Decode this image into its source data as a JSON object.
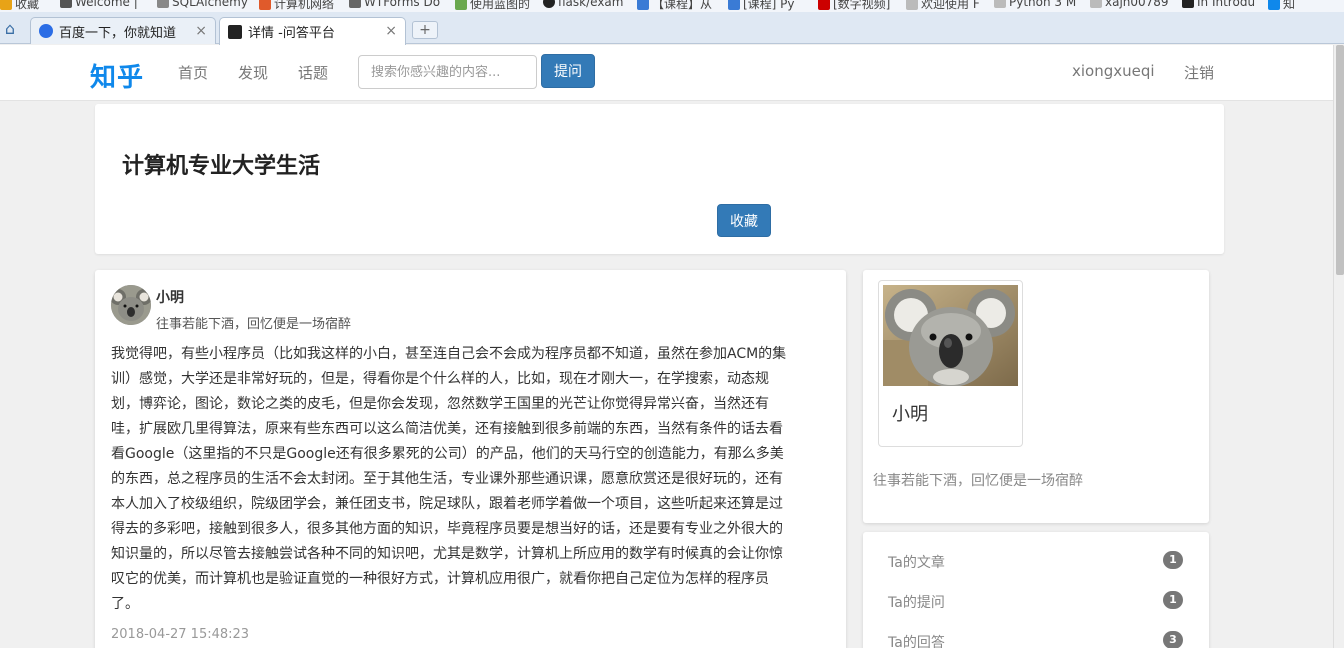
{
  "bookmarks": [
    {
      "label": "收藏",
      "icon": "star-icon",
      "color": "#e8a317"
    },
    {
      "label": "Welcome |",
      "icon": "site-icon",
      "color": "#555555"
    },
    {
      "label": "SQLAlchemy",
      "icon": "sqlalchemy-icon",
      "color": "#888888"
    },
    {
      "label": "计算机网络",
      "icon": "site-icon",
      "color": "#e05a2b"
    },
    {
      "label": "WTForms Do",
      "icon": "doc-icon",
      "color": "#666666"
    },
    {
      "label": "使用蓝图的",
      "icon": "site-icon",
      "color": "#6aa84f"
    },
    {
      "label": "flask/exam",
      "icon": "github-icon",
      "color": "#222222"
    },
    {
      "label": "【课程】从",
      "icon": "site-icon",
      "color": "#3a7bd5"
    },
    {
      "label": "[课程] Py",
      "icon": "site-icon",
      "color": "#3a7bd5"
    },
    {
      "label": "[数字视频]",
      "icon": "site-icon",
      "color": "#cc0000"
    },
    {
      "label": "欢迎使用 F",
      "icon": "page-icon",
      "color": "#888888"
    },
    {
      "label": "Python 3 M",
      "icon": "page-icon",
      "color": "#888888"
    },
    {
      "label": "xajh00789",
      "icon": "page-icon",
      "color": "#888888"
    },
    {
      "label": "In Introdu",
      "icon": "terminal-icon",
      "color": "#222222"
    },
    {
      "label": "知",
      "icon": "zhihu-icon",
      "color": "#0f88eb"
    }
  ],
  "tabs": [
    {
      "label": "百度一下，你就知道",
      "icon": "baidu-paw-icon",
      "icon_color": "#2b6de5",
      "active": false
    },
    {
      "label": "详情 -问答平台",
      "icon": "terminal-icon",
      "icon_color": "#222222",
      "active": true
    }
  ],
  "tab_close_glyph": "×",
  "new_tab_glyph": "+",
  "home_glyph": "⌂",
  "navbar": {
    "brand": "知乎",
    "links": [
      "首页",
      "发现",
      "话题"
    ],
    "search_placeholder": "搜索你感兴趣的内容...",
    "ask_button": "提问",
    "username": "xiongxueqi",
    "logout": "注销"
  },
  "question": {
    "title": "计算机专业大学生活",
    "favorite_button": "收藏"
  },
  "answer": {
    "author": "小明",
    "motto": "往事若能下酒，回忆便是一场宿醉",
    "body": "我觉得吧，有些小程序员（比如我这样的小白，甚至连自己会不会成为程序员都不知道，虽然在参加ACM的集训）感觉，大学还是非常好玩的，但是，得看你是个什么样的人，比如，现在才刚大一，在学搜索，动态规划，博弈论，图论，数论之类的皮毛，但是你会发现，忽然数学王国里的光芒让你觉得异常兴奋，当然还有哇，扩展欧几里得算法，原来有些东西可以这么简洁优美，还有接触到很多前端的东西，当然有条件的话去看看Google（这里指的不只是Google还有很多累死的公司）的产品，他们的天马行空的创造能力，有那么多美的东西，总之程序员的生活不会太封闭。至于其他生活，专业课外那些通识课，愿意欣赏还是很好玩的，还有本人加入了校级组织，院级团学会，兼任团支书，院足球队，跟着老师学着做一个项目，这些听起来还算是过得去的多彩吧，接触到很多人，很多其他方面的知识，毕竟程序员要是想当好的话，还是要有专业之外很大的知识量的，所以尽管去接触尝试各种不同的知识吧，尤其是数学，计算机上所应用的数学有时候真的会让你惊叹它的优美，而计算机也是验证直觉的一种很好方式，计算机应用很广，就看你把自己定位为怎样的程序员了。",
    "time": "2018-04-27 15:48:23"
  },
  "profile": {
    "name": "小明",
    "motto": "往事若能下酒，回忆便是一场宿醉"
  },
  "stats": [
    {
      "label": "Ta的文章",
      "count": "1"
    },
    {
      "label": "Ta的提问",
      "count": "1"
    },
    {
      "label": "Ta的回答",
      "count": "3"
    }
  ],
  "colors": {
    "brand": "#0f88eb",
    "primary_button": "#337ab7",
    "badge": "#777777"
  }
}
